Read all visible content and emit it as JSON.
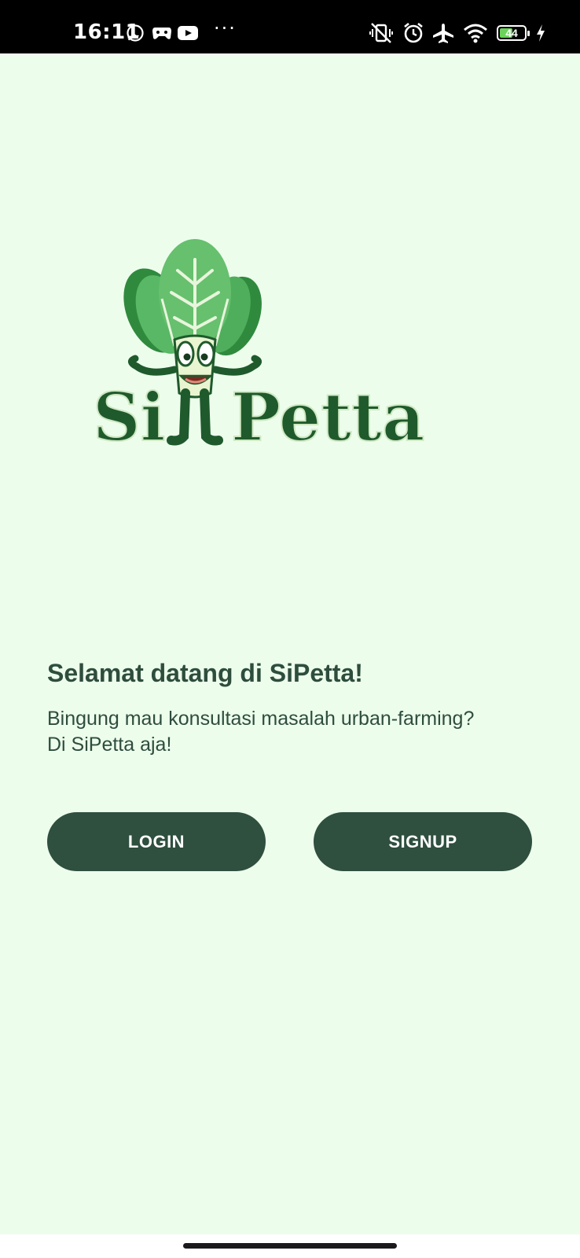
{
  "status_bar": {
    "time": "16:11",
    "more": "···",
    "battery": "44",
    "left_icons": [
      "whatsapp-icon",
      "game-icon",
      "youtube-icon"
    ],
    "right_icons": [
      "vibrate-off-icon",
      "alarm-icon",
      "airplane-icon",
      "wifi-icon",
      "battery-icon",
      "charging-icon"
    ]
  },
  "logo": {
    "text": "SiPetta"
  },
  "welcome": {
    "title": "Selamat datang di SiPetta!",
    "description_line1": "Bingung mau konsultasi masalah urban-farming?",
    "description_line2": "Di SiPetta aja!"
  },
  "buttons": {
    "login": "LOGIN",
    "signup": "SIGNUP"
  },
  "colors": {
    "background": "#edfdec",
    "button": "#2f4f3f",
    "text": "#2e4d3d",
    "logo_green": "#1f5a2c",
    "leaf": "#52b55c"
  }
}
